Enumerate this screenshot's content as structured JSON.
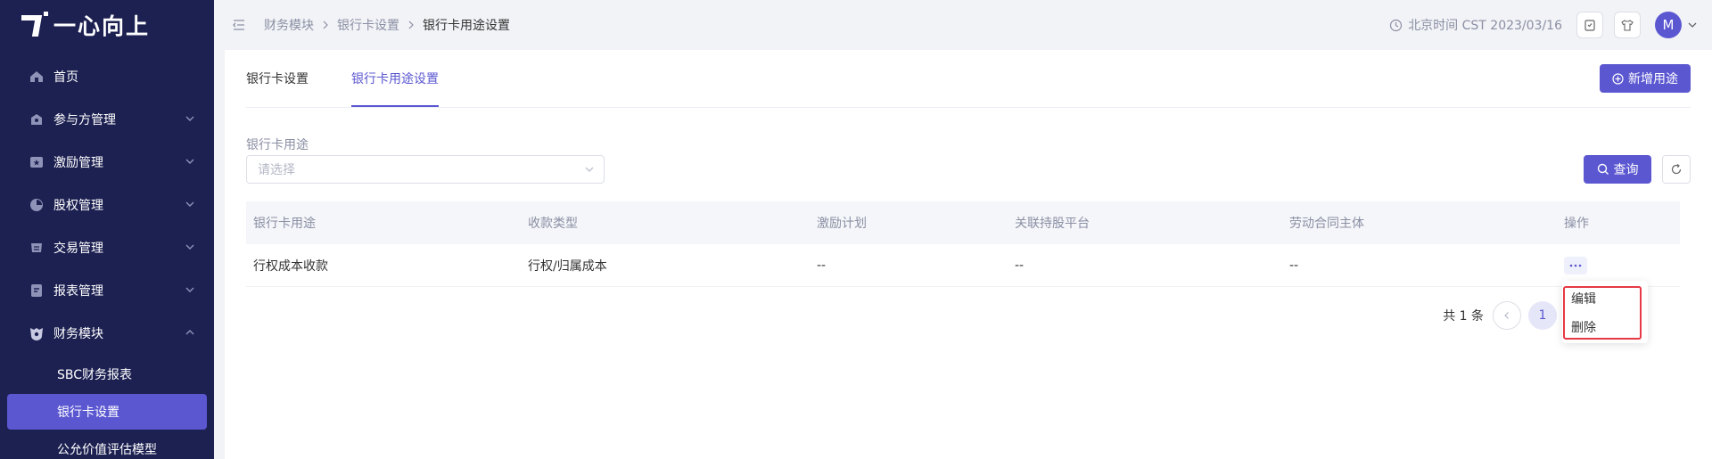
{
  "brand": {
    "name": "一心向上"
  },
  "sidebar": {
    "items": [
      {
        "label": "首页",
        "icon": "home-icon",
        "has_children": false
      },
      {
        "label": "参与方管理",
        "icon": "participant-icon",
        "has_children": true
      },
      {
        "label": "激励管理",
        "icon": "incentive-icon",
        "has_children": true
      },
      {
        "label": "股权管理",
        "icon": "equity-icon",
        "has_children": true
      },
      {
        "label": "交易管理",
        "icon": "trade-icon",
        "has_children": true
      },
      {
        "label": "报表管理",
        "icon": "report-icon",
        "has_children": true
      },
      {
        "label": "财务模块",
        "icon": "finance-icon",
        "has_children": true,
        "expanded": true
      }
    ],
    "subitems": [
      {
        "label": "SBC财务报表",
        "active": false
      },
      {
        "label": "银行卡设置",
        "active": true
      },
      {
        "label": "公允价值评估模型",
        "active": false
      }
    ]
  },
  "header": {
    "breadcrumb": [
      "财务模块",
      "银行卡设置",
      "银行卡用途设置"
    ],
    "clock": "北京时间 CST 2023/03/16",
    "avatar": "M"
  },
  "tabs": [
    {
      "label": "银行卡设置",
      "active": false
    },
    {
      "label": "银行卡用途设置",
      "active": true
    }
  ],
  "actions": {
    "add_label": "新增用途",
    "query_label": "查询"
  },
  "filter": {
    "label": "银行卡用途",
    "placeholder": "请选择"
  },
  "table": {
    "columns": [
      "银行卡用途",
      "收款类型",
      "激励计划",
      "关联持股平台",
      "劳动合同主体",
      "操作"
    ],
    "rows": [
      [
        "行权成本收款",
        "行权/归属成本",
        "--",
        "--",
        "--"
      ]
    ]
  },
  "pagination": {
    "total_text": "共 1 条",
    "current_page": "1"
  },
  "row_menu": {
    "items": [
      "编辑",
      "删除"
    ]
  },
  "colors": {
    "sidebar_bg": "#1d2152",
    "accent": "#5b57d1",
    "highlight_border": "#e63946"
  }
}
